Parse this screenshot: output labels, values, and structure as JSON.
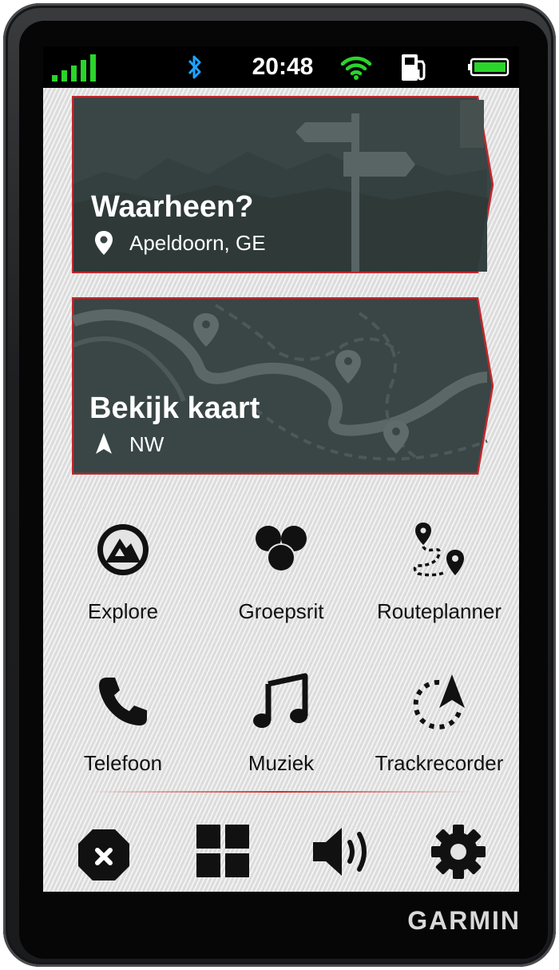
{
  "status_bar": {
    "time": "20:48",
    "icons": [
      "signal-icon",
      "bluetooth-icon",
      "wifi-icon",
      "fuel-icon",
      "battery-icon"
    ],
    "signal_color": "#2bd42b",
    "bluetooth_color": "#1fa3ff",
    "wifi_color": "#2bd42b"
  },
  "cards": {
    "where_to": {
      "title": "Waarheen?",
      "subtitle": "Apeldoorn, GE",
      "icon": "location-pin-icon"
    },
    "view_map": {
      "title": "Bekijk kaart",
      "subtitle": "NW",
      "icon": "heading-arrow-icon"
    }
  },
  "apps": [
    {
      "label": "Explore",
      "icon": "explore-icon"
    },
    {
      "label": "Groepsrit",
      "icon": "group-ride-icon"
    },
    {
      "label": "Routeplanner",
      "icon": "route-planner-icon"
    },
    {
      "label": "Telefoon",
      "icon": "phone-icon"
    },
    {
      "label": "Muziek",
      "icon": "music-icon"
    },
    {
      "label": "Trackrecorder",
      "icon": "track-recorder-icon"
    }
  ],
  "bottom_bar": [
    "stop-icon",
    "apps-grid-icon",
    "volume-icon",
    "settings-gear-icon"
  ],
  "brand": "GARMIN",
  "colors": {
    "card_bg": "#3a4545",
    "card_border": "#c0282d",
    "accent_red": "#d42a2a"
  }
}
